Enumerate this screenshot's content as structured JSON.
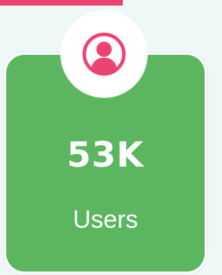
{
  "stat": {
    "value": "53K",
    "label": "Users"
  },
  "icon": "user-circle-icon",
  "colors": {
    "accent": "#ec4471",
    "card": "#5cb660",
    "background": "#eef8f6",
    "text": "#ffffff"
  }
}
